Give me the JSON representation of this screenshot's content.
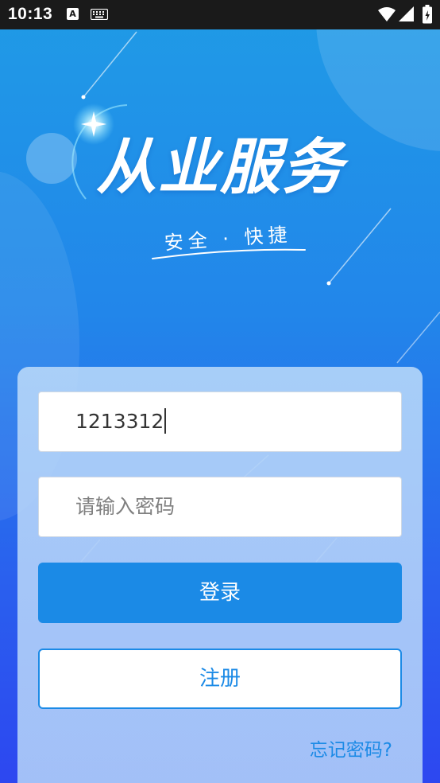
{
  "status_bar": {
    "time": "10:13",
    "icons": [
      "a-icon",
      "keyboard-icon",
      "wifi-icon",
      "signal-icon",
      "battery-icon"
    ],
    "a_glyph": "A"
  },
  "header": {
    "title": "从业服务",
    "subtitle": "安全 · 快捷"
  },
  "login": {
    "username_value": "1213312",
    "password_placeholder": "请输入密码",
    "login_label": "登录",
    "register_label": "注册",
    "forgot_label": "忘记密码?"
  },
  "colors": {
    "accent": "#1b8ae6",
    "bg_top": "#1f9be6",
    "bg_bottom": "#2d47f0",
    "status_bar": "#1a1a1a"
  }
}
